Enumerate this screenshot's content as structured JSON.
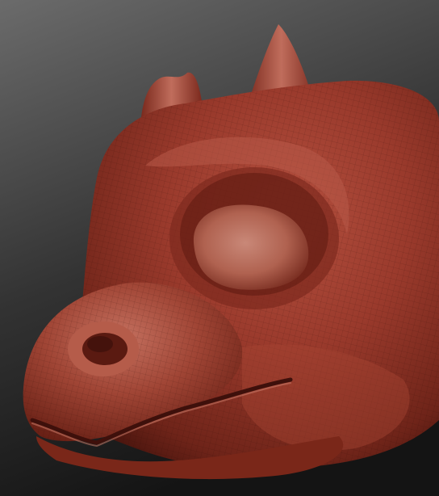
{
  "viewport": {
    "background_top": "#6b6b6b",
    "background_bottom": "#141414"
  },
  "model": {
    "subject": "dragon-head-sculpt",
    "material": "red-wax",
    "base_color": "#8e3326",
    "highlight_color": "#d08070",
    "shadow_color": "#3e100b",
    "wireframe_visible": true
  }
}
